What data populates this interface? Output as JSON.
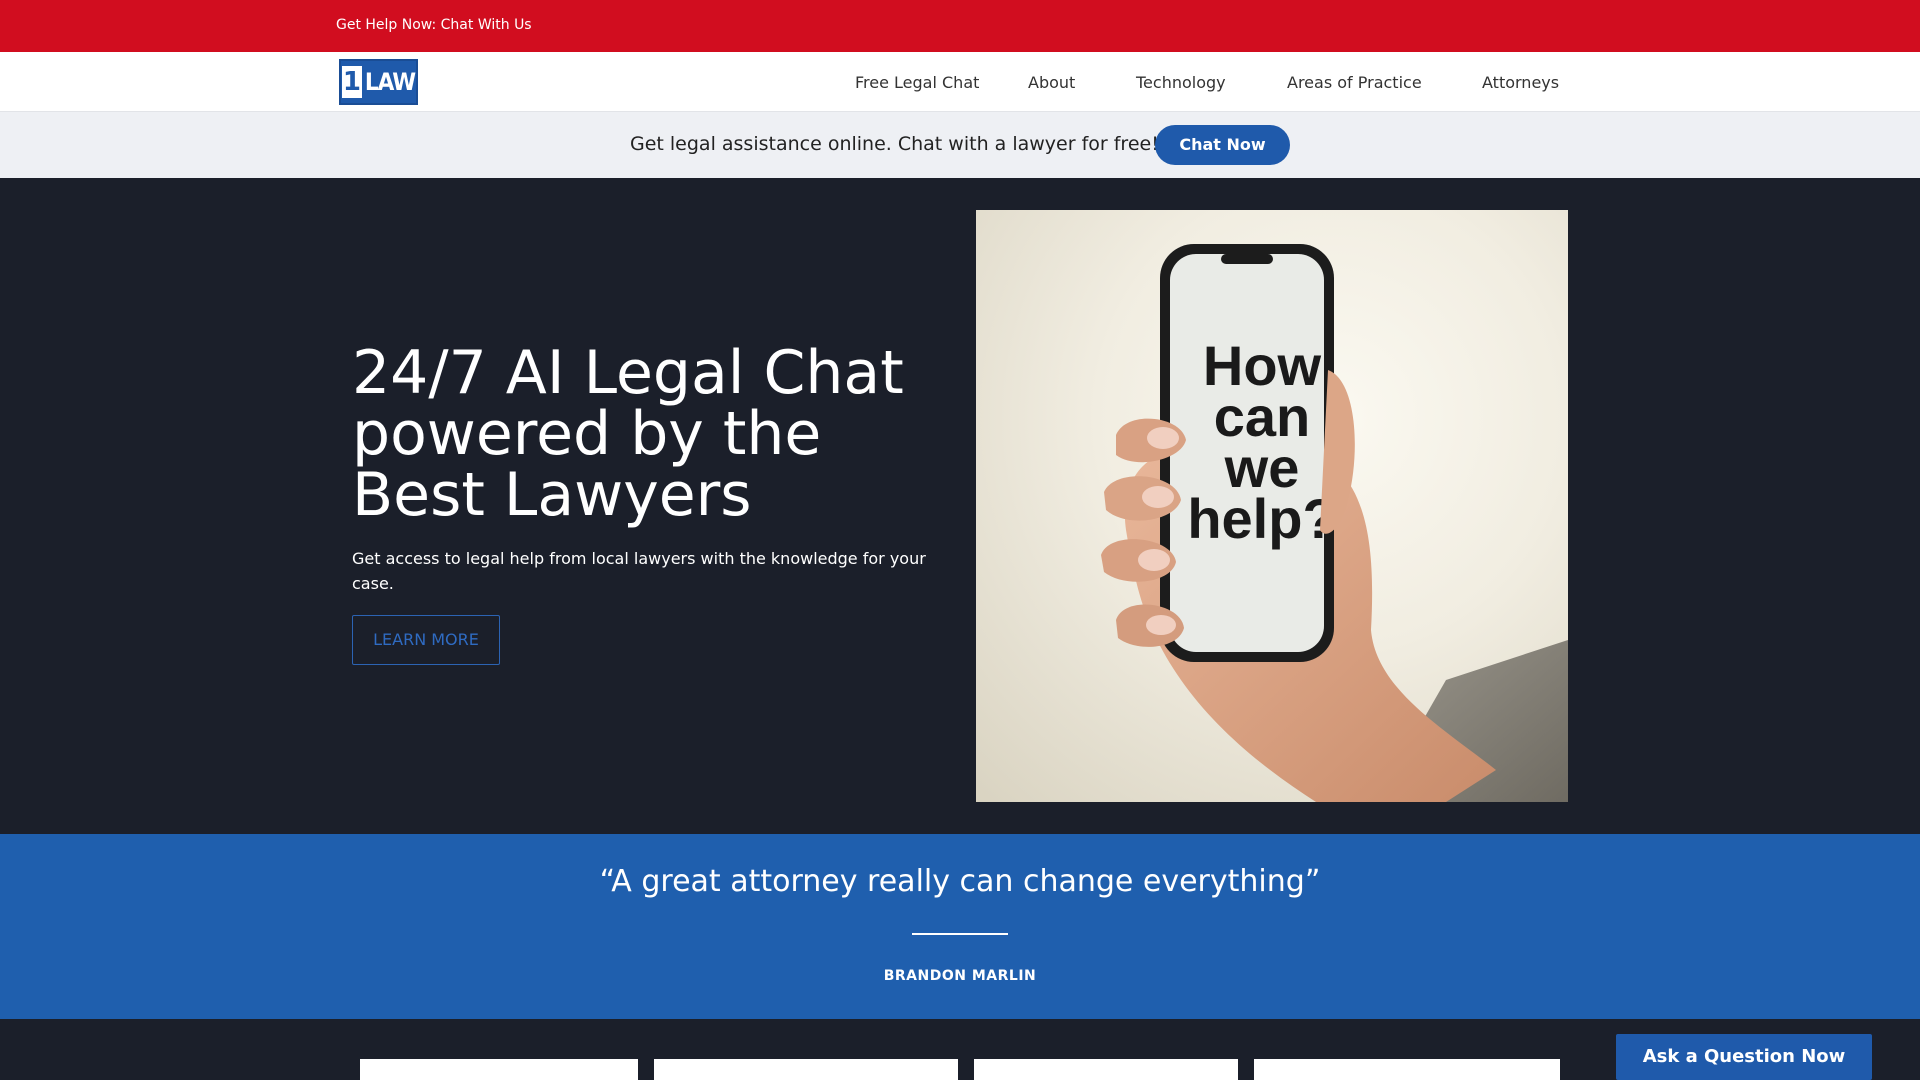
{
  "topbar": {
    "help_link": "Get Help Now: Chat With Us"
  },
  "header": {
    "logo": {
      "number": "1",
      "word": "LAW"
    },
    "nav": [
      {
        "label": "Free Legal Chat"
      },
      {
        "label": "About"
      },
      {
        "label": "Technology"
      },
      {
        "label": "Areas of Practice"
      },
      {
        "label": "Attorneys"
      }
    ]
  },
  "promo": {
    "text": "Get legal assistance online. Chat with a lawyer for free!",
    "button": "Chat Now"
  },
  "hero": {
    "title": "24/7 AI Legal Chat powered by the Best Lawyers",
    "subtitle": "Get access to legal help from local lawyers with the knowledge for your case.",
    "cta": "LEARN MORE",
    "image_text": [
      "How",
      "can",
      "we",
      "help?"
    ]
  },
  "quote": {
    "text": "“A great attorney really can change everything”",
    "author": "BRANDON MARLIN"
  },
  "floating": {
    "ask_button": "Ask a Question Now"
  },
  "colors": {
    "topbar": "#d10d1f",
    "brand_blue": "#1f5aab",
    "hero_bg": "#1b1f2a",
    "promo_bg": "#eef0f4"
  }
}
